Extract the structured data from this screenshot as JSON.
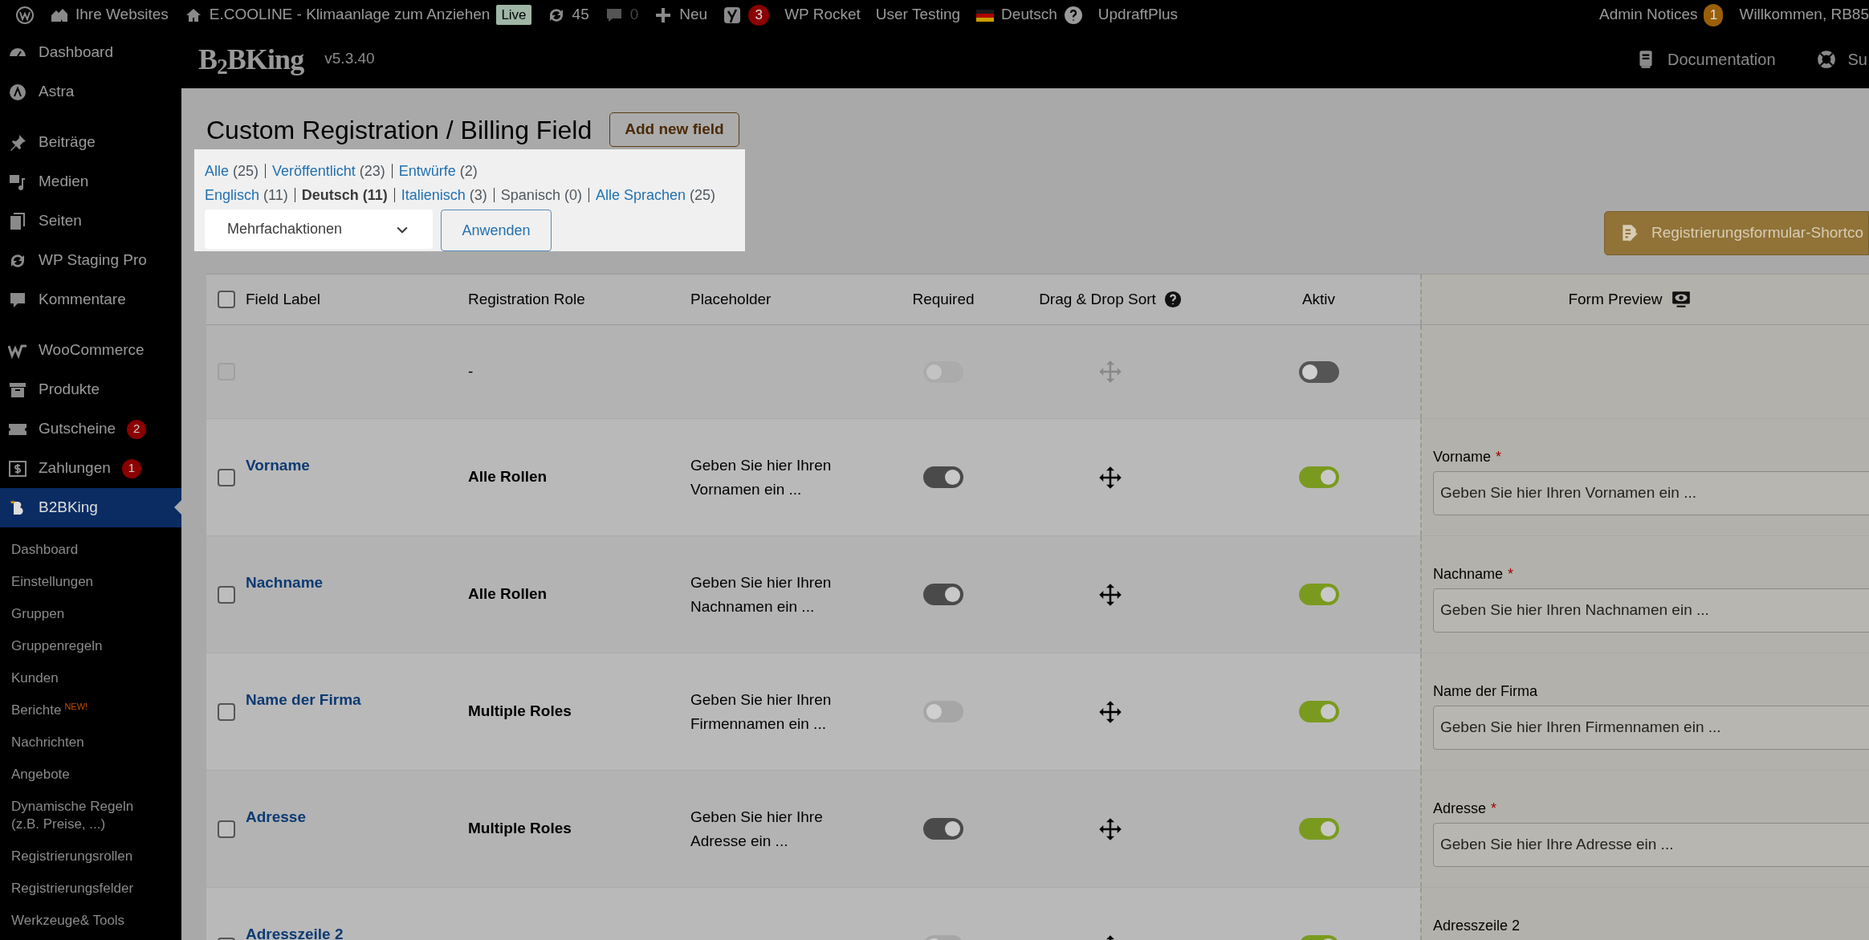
{
  "admin_bar": {
    "items": [
      {
        "label": "Ihre Websites"
      },
      {
        "label": "E.COOLINE - Klimaanlage zum Anziehen",
        "tag": "Live"
      },
      {
        "label": "45"
      },
      {
        "label": "0",
        "disabled": true
      },
      {
        "label": "Neu"
      },
      {
        "badge": "3"
      },
      {
        "label": "WP Rocket"
      },
      {
        "label": "User Testing"
      },
      {
        "label": "Deutsch"
      },
      {
        "label": "UpdraftPlus"
      }
    ],
    "right": [
      {
        "label": "Admin Notices",
        "badge": "1"
      },
      {
        "label": "Willkommen, RB85"
      }
    ]
  },
  "sidebar": {
    "groups": [
      [
        {
          "label": "Dashboard",
          "selected": false
        },
        {
          "label": "Astra",
          "selected": false
        }
      ],
      [
        {
          "label": "Beiträge",
          "selected": false
        },
        {
          "label": "Medien",
          "selected": false
        },
        {
          "label": "Seiten",
          "selected": false
        },
        {
          "label": "WP Staging Pro",
          "selected": false
        },
        {
          "label": "Kommentare",
          "selected": false
        }
      ],
      [
        {
          "label": "WooCommerce",
          "selected": false
        },
        {
          "label": "Produkte",
          "selected": false
        },
        {
          "label": "Gutscheine",
          "badge": "2",
          "selected": false
        },
        {
          "label": "Zahlungen",
          "badge": "1",
          "selected": false
        },
        {
          "label": "B2BKing",
          "selected": true
        }
      ]
    ],
    "submenu": [
      {
        "label": "Dashboard"
      },
      {
        "label": "Einstellungen"
      },
      {
        "label": "Gruppen"
      },
      {
        "label": "Gruppenregeln"
      },
      {
        "label": "Kunden"
      },
      {
        "label": "Berichte",
        "tag": "NEW!"
      },
      {
        "label": "Nachrichten"
      },
      {
        "label": "Angebote"
      },
      {
        "label": "Dynamische Regeln (z.B. Preise, ...)"
      },
      {
        "label": "Registrierungsrollen"
      },
      {
        "label": "Registrierungsfelder"
      },
      {
        "label": "Werkzeuge& Tools"
      }
    ]
  },
  "plugin_header": {
    "logo": "B$_{2}$BKing",
    "version": "v5.3.40",
    "links": [
      {
        "label": "Documentation"
      },
      {
        "label": "Su"
      }
    ]
  },
  "page": {
    "title": "Custom Registration / Billing Field",
    "add_button": "Add new field",
    "status_filters": [
      {
        "label": "Alle",
        "count": "(25)"
      },
      {
        "label": "Veröffentlicht",
        "count": "(23)"
      },
      {
        "label": "Entwürfe",
        "count": "(2)"
      }
    ],
    "language_filters": [
      {
        "label": "Englisch",
        "count": "(11)",
        "selected": false,
        "disabled": false
      },
      {
        "label": "Deutsch",
        "count": "(11)",
        "selected": true,
        "disabled": false
      },
      {
        "label": "Italienisch",
        "count": "(3)",
        "selected": false,
        "disabled": false
      },
      {
        "label": "Spanisch",
        "count": "(0)",
        "selected": false,
        "disabled": true
      },
      {
        "label": "Alle Sprachen",
        "count": "(25)",
        "selected": false,
        "disabled": false
      }
    ],
    "bulk_action": {
      "value": "Mehrfachaktionen"
    },
    "apply_button": "Anwenden",
    "shortcode_button": "Registrierungsformular-Shortco"
  },
  "table": {
    "select_all": {
      "checked": false
    },
    "columns": [
      "Field Label",
      "Registration Role",
      "Placeholder",
      "Required",
      "Drag & Drop Sort",
      "Aktiv",
      "Form Preview"
    ],
    "rows": [
      {
        "role": "-",
        "checked": false,
        "disabled": true,
        "required": false,
        "aktiv": false
      },
      {
        "label": "Vorname",
        "role": "Alle Rollen",
        "placeholder": "Geben Sie hier Ihren Vornamen ein ...",
        "checked": false,
        "disabled": false,
        "required": true,
        "aktiv": true,
        "preview": {
          "label": "Vorname",
          "required_mark": "*",
          "placeholder": "Geben Sie hier Ihren Vornamen ein ..."
        }
      },
      {
        "label": "Nachname",
        "role": "Alle Rollen",
        "placeholder": "Geben Sie hier Ihren Nachnamen ein ...",
        "checked": false,
        "disabled": false,
        "required": true,
        "aktiv": true,
        "preview": {
          "label": "Nachname",
          "required_mark": "*",
          "placeholder": "Geben Sie hier Ihren Nachnamen ein ..."
        }
      },
      {
        "label": "Name der Firma",
        "role": "Multiple Roles",
        "placeholder": "Geben Sie hier Ihren Firmennamen ein ...",
        "checked": false,
        "disabled": false,
        "required": false,
        "aktiv": true,
        "preview": {
          "label": "Name der Firma",
          "placeholder": "Geben Sie hier Ihren Firmennamen ein ..."
        }
      },
      {
        "label": "Adresse",
        "role": "Multiple Roles",
        "placeholder": "Geben Sie hier Ihre Adresse ein ...",
        "checked": false,
        "disabled": false,
        "required": true,
        "aktiv": true,
        "preview": {
          "label": "Adresse",
          "required_mark": "*",
          "placeholder": "Geben Sie hier Ihre Adresse ein ..."
        }
      },
      {
        "label": "Adresszeile 2",
        "checked": false,
        "disabled": false,
        "required": false,
        "aktiv": true,
        "preview": {
          "label": "Adresszeile 2"
        }
      }
    ]
  }
}
